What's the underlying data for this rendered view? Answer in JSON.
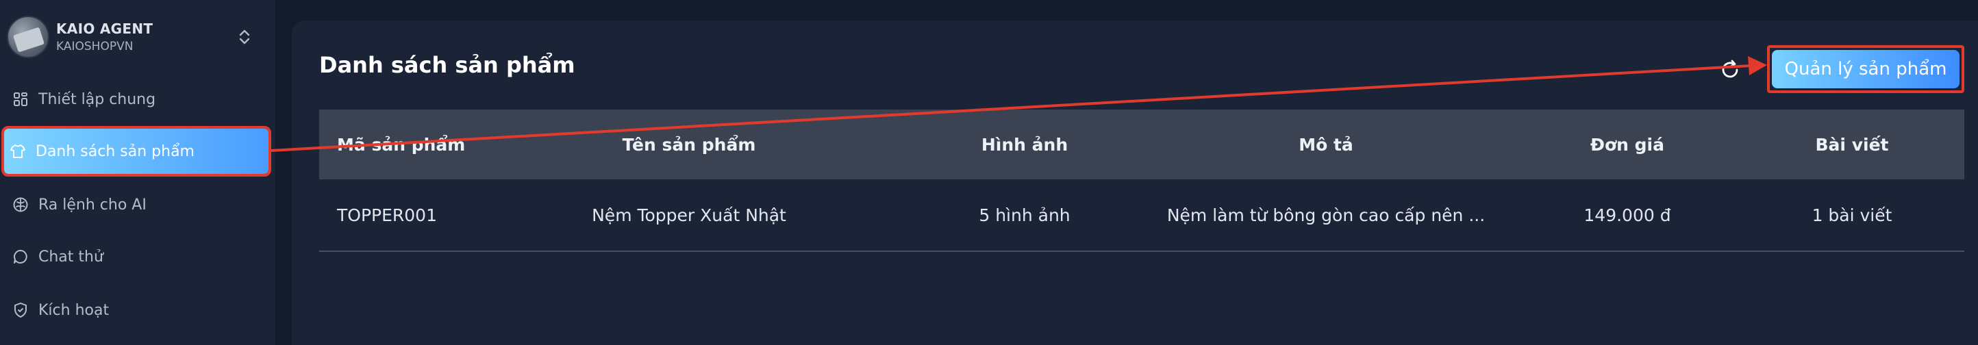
{
  "account": {
    "name": "KAIO AGENT",
    "shop": "KAIOSHOPVN"
  },
  "sidebar": {
    "items": [
      {
        "label": "Thiết lập chung",
        "icon": "grid-icon"
      },
      {
        "label": "Danh sách sản phẩm",
        "icon": "shirt-icon",
        "active": true
      },
      {
        "label": "Ra lệnh cho AI",
        "icon": "brain-icon"
      },
      {
        "label": "Chat thử",
        "icon": "chat-icon"
      },
      {
        "label": "Kích hoạt",
        "icon": "shield-icon"
      }
    ]
  },
  "main": {
    "title": "Danh sách sản phẩm",
    "manage_button": "Quản lý sản phẩm",
    "refresh_icon": "refresh-icon"
  },
  "table": {
    "headers": [
      "Mã sản phẩm",
      "Tên sản phẩm",
      "Hình ảnh",
      "Mô tả",
      "Đơn giá",
      "Bài viết"
    ],
    "rows": [
      [
        "TOPPER001",
        "Nệm Topper Xuất Nhật",
        "5 hình ảnh",
        "Nệm làm từ bông gòn cao cấp nên ...",
        "149.000 đ",
        "1 bài viết"
      ]
    ]
  },
  "colors": {
    "accent_start": "#7fd5ff",
    "accent_end": "#4a9dff",
    "annotation": "#e23a2c",
    "background": "#131a2c",
    "panel": "#1b2336"
  }
}
